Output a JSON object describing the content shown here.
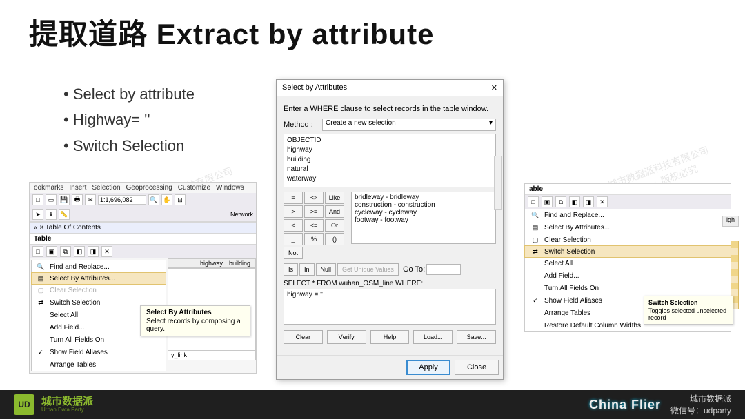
{
  "slide_title": "提取道路 Extract by attribute",
  "bullets": [
    "Select by attribute",
    "Highway= ''",
    "Switch Selection"
  ],
  "panel1": {
    "menubar": [
      "ookmarks",
      "Insert",
      "Selection",
      "Geoprocessing",
      "Customize",
      "Windows"
    ],
    "scale_value": "1:1,696,082",
    "toc_label": "Table Of Contents",
    "net_label": "Network",
    "table_label": "Table",
    "tab_tools_icons": [
      "□",
      "▣",
      "⧉",
      "◧",
      "◨",
      "✕"
    ],
    "col_headers": [
      "",
      "highway",
      "building"
    ],
    "last_value": "y_link",
    "menu": [
      {
        "icon": "🔍",
        "label": "Find and Replace...",
        "key": "find-replace",
        "disabled": false
      },
      {
        "icon": "▤",
        "label": "Select By Attributes...",
        "key": "select-by-attributes",
        "disabled": false,
        "hover": true
      },
      {
        "icon": "▢",
        "label": "Clear Selection",
        "key": "clear-selection",
        "disabled": true
      },
      {
        "icon": "⇄",
        "label": "Switch Selection",
        "key": "switch-selection",
        "disabled": false
      },
      {
        "icon": "",
        "label": "Select All",
        "key": "select-all",
        "disabled": false
      },
      {
        "icon": "",
        "label": "Add Field...",
        "key": "add-field",
        "disabled": false
      },
      {
        "icon": "",
        "label": "Turn All Fields On",
        "key": "all-fields-on",
        "disabled": false
      },
      {
        "icon": "✓",
        "label": "Show Field Aliases",
        "key": "show-aliases",
        "disabled": false
      },
      {
        "icon": "",
        "label": "Arrange Tables",
        "key": "arrange-tables",
        "disabled": false
      }
    ],
    "tooltip_title": "Select By Attributes",
    "tooltip_text": "Select records by composing a query."
  },
  "dlg": {
    "title": "Select by Attributes",
    "close": "✕",
    "instr": "Enter a WHERE clause to select records in the table window.",
    "method_label": "Method :",
    "method_value": "Create a new selection",
    "fields": [
      "OBJECTID",
      "highway",
      "building",
      "natural",
      "waterway"
    ],
    "ops": [
      "=",
      "<>",
      "Like",
      ">",
      ">=",
      "And",
      "<",
      "<=",
      "Or",
      "_",
      "%",
      "()",
      "Not"
    ],
    "extra_ops": [
      "Is",
      "In",
      "Null"
    ],
    "uniq_btn": "Get Unique Values",
    "goto_label": "Go To:",
    "values": [
      "bridleway - bridleway",
      "construction - construction",
      "cycleway - cycleway",
      "footway - footway"
    ],
    "sql_line": "SELECT * FROM wuhan_OSM_line WHERE:",
    "expr": "highway = ''",
    "btns": [
      "Clear",
      "Verify",
      "Help",
      "Load...",
      "Save..."
    ],
    "apply": "Apply",
    "close_btn": "Close"
  },
  "panel3": {
    "header": "able",
    "tools": [
      "□",
      "▣",
      "⧉",
      "◧",
      "◨",
      "✕"
    ],
    "col_right": "igh",
    "menu": [
      {
        "icon": "🔍",
        "label": "Find and Replace...",
        "key": "find-replace"
      },
      {
        "icon": "▤",
        "label": "Select By Attributes...",
        "key": "select-by-attributes"
      },
      {
        "icon": "▢",
        "label": "Clear Selection",
        "key": "clear-selection"
      },
      {
        "icon": "⇄",
        "label": "Switch Selection",
        "key": "switch-selection",
        "hover": true
      },
      {
        "icon": "",
        "label": "Select All",
        "key": "select-all"
      },
      {
        "icon": "",
        "label": "Add Field...",
        "key": "add-field"
      },
      {
        "icon": "",
        "label": "Turn All Fields On",
        "key": "all-fields-on"
      },
      {
        "icon": "✓",
        "label": "Show Field Aliases",
        "key": "show-aliases"
      },
      {
        "icon": "",
        "label": "Arrange Tables",
        "key": "arrange-tables",
        "arrow": "▸"
      },
      {
        "icon": "",
        "label": "Restore Default Column Widths",
        "key": "restore-widths"
      }
    ],
    "tooltip_title": "Switch Selection",
    "tooltip_text": "Toggles selected unselected record"
  },
  "footer": {
    "brand_cn": "城市数据派",
    "brand_en": "Urban Data Party",
    "logo": "UD",
    "right1": "城市数据派",
    "right2": "微信号：udparty",
    "cflier": "China Flier"
  },
  "watermark": "深圳市城市数据派科技有限公司\n   公众号: udparty  版权必究"
}
